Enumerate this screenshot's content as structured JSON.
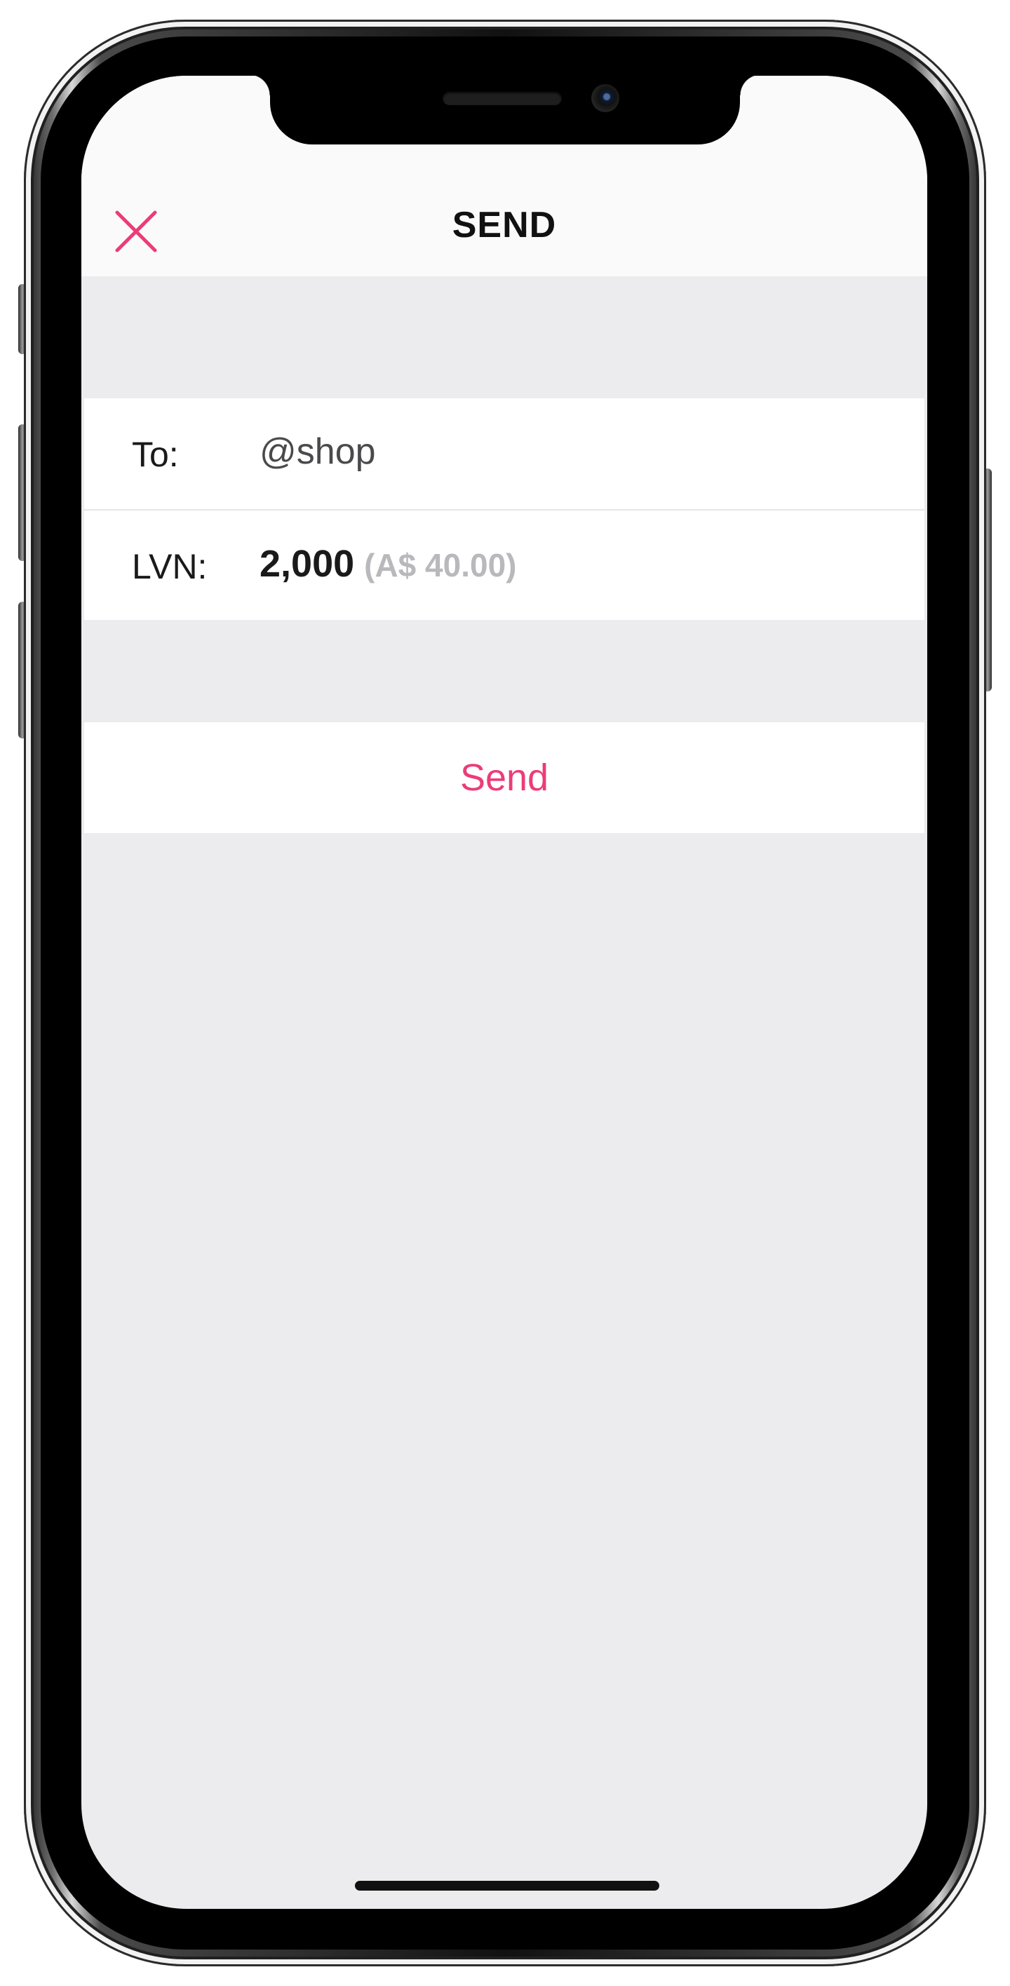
{
  "colors": {
    "accent": "#ec3c78",
    "background": "#ececee",
    "nav_background": "#fafafa",
    "row_background": "#ffffff",
    "muted_text": "#b9b9bd"
  },
  "nav": {
    "title": "SEND",
    "close_icon": "close-x-icon"
  },
  "form": {
    "recipient": {
      "label": "To:",
      "value": "@shop"
    },
    "amount": {
      "label": "LVN:",
      "value": "2,000",
      "fiat_value": "(A$ 40.00)"
    }
  },
  "actions": {
    "send_label": "Send"
  }
}
